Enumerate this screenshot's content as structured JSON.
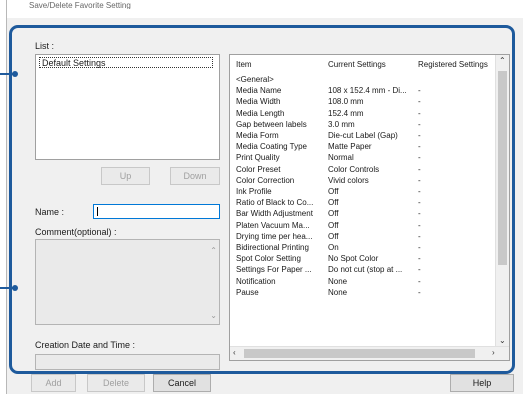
{
  "window": {
    "title": "Save/Delete Favorite Setting"
  },
  "left": {
    "list_label": "List :",
    "list_items": [
      "Default Settings"
    ],
    "up_label": "Up",
    "down_label": "Down",
    "name_label": "Name :",
    "name_value": "",
    "comment_label": "Comment(optional) :",
    "date_label": "Creation Date and Time :"
  },
  "table": {
    "headers": [
      "Item",
      "Current Settings",
      "Registered Settings"
    ],
    "rows": [
      [
        "<General>",
        "",
        ""
      ],
      [
        "Media Name",
        "108 x 152.4 mm - Di...",
        "-"
      ],
      [
        "Media Width",
        "108.0 mm",
        "-"
      ],
      [
        "Media Length",
        "152.4 mm",
        "-"
      ],
      [
        "Gap between labels",
        "3.0 mm",
        "-"
      ],
      [
        "Media Form",
        "Die-cut Label (Gap)",
        "-"
      ],
      [
        "Media Coating Type",
        "Matte Paper",
        "-"
      ],
      [
        "Print Quality",
        "Normal",
        "-"
      ],
      [
        "Color Preset",
        "Color Controls",
        "-"
      ],
      [
        "Color Correction",
        "Vivid colors",
        "-"
      ],
      [
        "Ink Profile",
        "Off",
        "-"
      ],
      [
        "Ratio of Black to Co...",
        "Off",
        "-"
      ],
      [
        "Bar Width Adjustment",
        "Off",
        "-"
      ],
      [
        "Platen Vacuum Ma...",
        "Off",
        "-"
      ],
      [
        "Drying time per hea...",
        "Off",
        "-"
      ],
      [
        "Bidirectional Printing",
        "On",
        "-"
      ],
      [
        "Spot Color Setting",
        "No Spot Color",
        "-"
      ],
      [
        "Settings For Paper ...",
        "Do not cut (stop at ...",
        "-"
      ],
      [
        "Notification",
        "None",
        "-"
      ],
      [
        "Pause",
        "None",
        "-"
      ]
    ]
  },
  "footer": {
    "add_label": "Add",
    "delete_label": "Delete",
    "cancel_label": "Cancel",
    "help_label": "Help"
  },
  "colors": {
    "highlight": "#1e5a9c",
    "focus": "#0078d7"
  }
}
